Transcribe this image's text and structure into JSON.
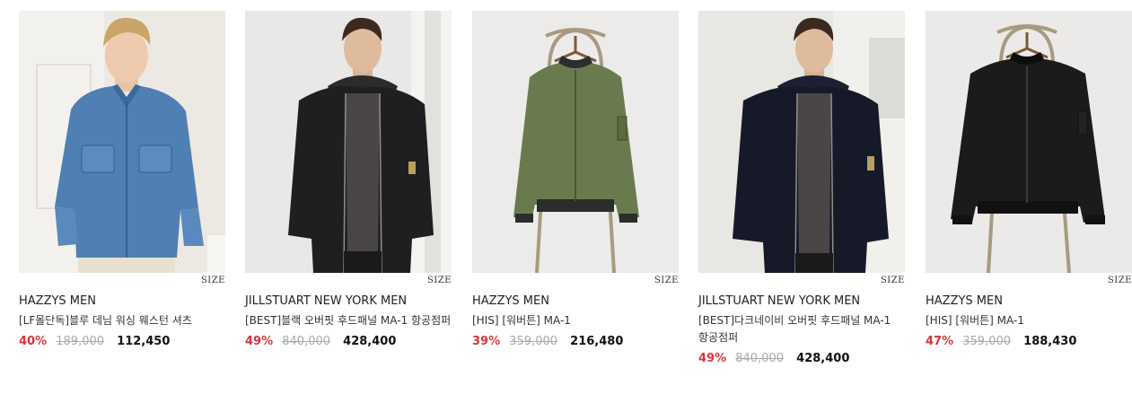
{
  "size_label": "SIZE",
  "products": [
    {
      "brand": "HAZZYS MEN",
      "name": "[LF몰단독]블루 데님 워싱 웨스턴 셔츠",
      "discount": "40%",
      "original_price": "189,000",
      "sale_price": "112,450",
      "image": "denim-shirt-model"
    },
    {
      "brand": "JILLSTUART NEW YORK MEN",
      "name": "[BEST]블랙 오버핏 후드패널 MA-1 항공점퍼",
      "discount": "49%",
      "original_price": "840,000",
      "sale_price": "428,400",
      "image": "black-hooded-jacket-model"
    },
    {
      "brand": "HAZZYS MEN",
      "name": "[HIS] [워버튼] MA-1",
      "discount": "39%",
      "original_price": "359,000",
      "sale_price": "216,480",
      "image": "khaki-ma1-on-chair"
    },
    {
      "brand": "JILLSTUART NEW YORK MEN",
      "name": "[BEST]다크네이비 오버핏 후드패널 MA-1 항공점퍼",
      "discount": "49%",
      "original_price": "840,000",
      "sale_price": "428,400",
      "image": "navy-hooded-jacket-model"
    },
    {
      "brand": "HAZZYS MEN",
      "name": "[HIS] [워버튼] MA-1",
      "discount": "47%",
      "original_price": "359,000",
      "sale_price": "188,430",
      "image": "black-ma1-on-chair"
    }
  ]
}
